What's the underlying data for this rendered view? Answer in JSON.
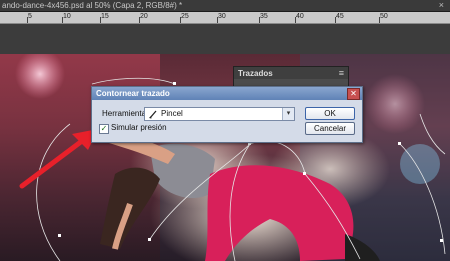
{
  "document": {
    "tab_title": "ando-dance-4x456.psd al 50% (Capa 2, RGB/8#) *",
    "close_glyph": "×"
  },
  "ruler": {
    "labels": [
      "5",
      "10",
      "15",
      "20",
      "25",
      "30",
      "35",
      "40",
      "45",
      "50"
    ]
  },
  "paths_panel": {
    "tab_label": "Trazados",
    "menu_glyph": "≡"
  },
  "dialog": {
    "title": "Contornear trazado",
    "close_glyph": "✕",
    "tool_label": "Herramienta:",
    "tool_value": "Pincel",
    "dropdown_glyph": "▾",
    "simulate_pressure_label": "Simular presión",
    "simulate_pressure_checked": true,
    "check_glyph": "✓",
    "ok_label": "OK",
    "cancel_label": "Cancelar"
  },
  "colors": {
    "dialog_title_bar": "#5f82b6",
    "annotation_arrow": "#e8202a",
    "path_stroke": "#e6e6e6"
  }
}
